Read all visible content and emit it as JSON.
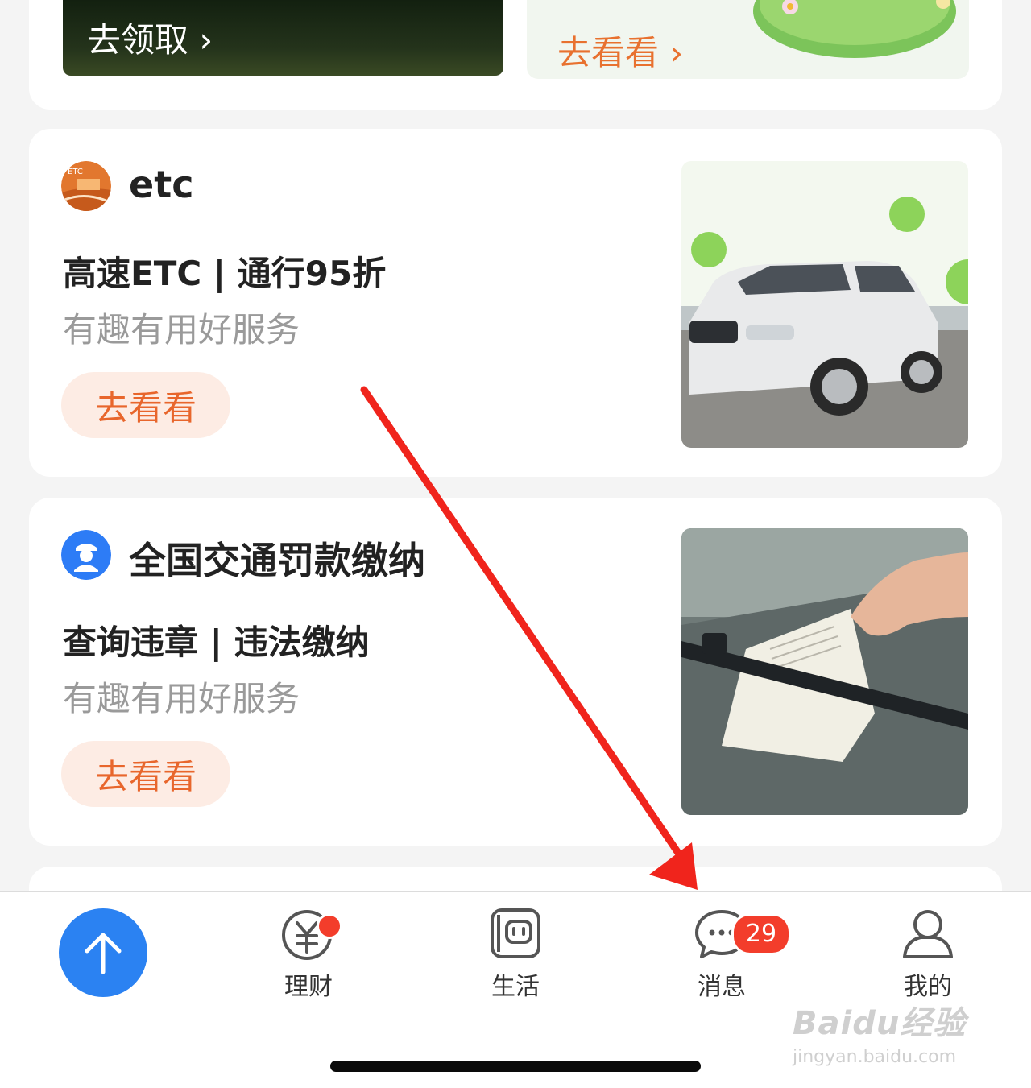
{
  "top_banners": {
    "left_label": "去领取",
    "right_label": "去看看"
  },
  "services": [
    {
      "name": "etc",
      "tagline": "高速ETC | 通行95折",
      "description": "有趣有用好服务",
      "button_label": "去看看",
      "logo_text": "ETC"
    },
    {
      "name": "全国交通罚款缴纳",
      "tagline": "查询违章 | 违法缴纳",
      "description": "有趣有用好服务",
      "button_label": "去看看"
    }
  ],
  "tabbar": {
    "tabs": [
      {
        "label": "理财",
        "icon": "yen-icon"
      },
      {
        "label": "生活",
        "icon": "life-icon"
      },
      {
        "label": "消息",
        "icon": "chat-bubble-icon",
        "badge": "29"
      },
      {
        "label": "我的",
        "icon": "user-icon"
      }
    ]
  },
  "watermark": {
    "main": "Baidu经验",
    "sub": "jingyan.baidu.com"
  },
  "colors": {
    "accent_orange": "#e8662c",
    "badge_red": "#f33d2b",
    "fab_blue": "#2b82f2",
    "annotation_red": "#f0241c"
  }
}
